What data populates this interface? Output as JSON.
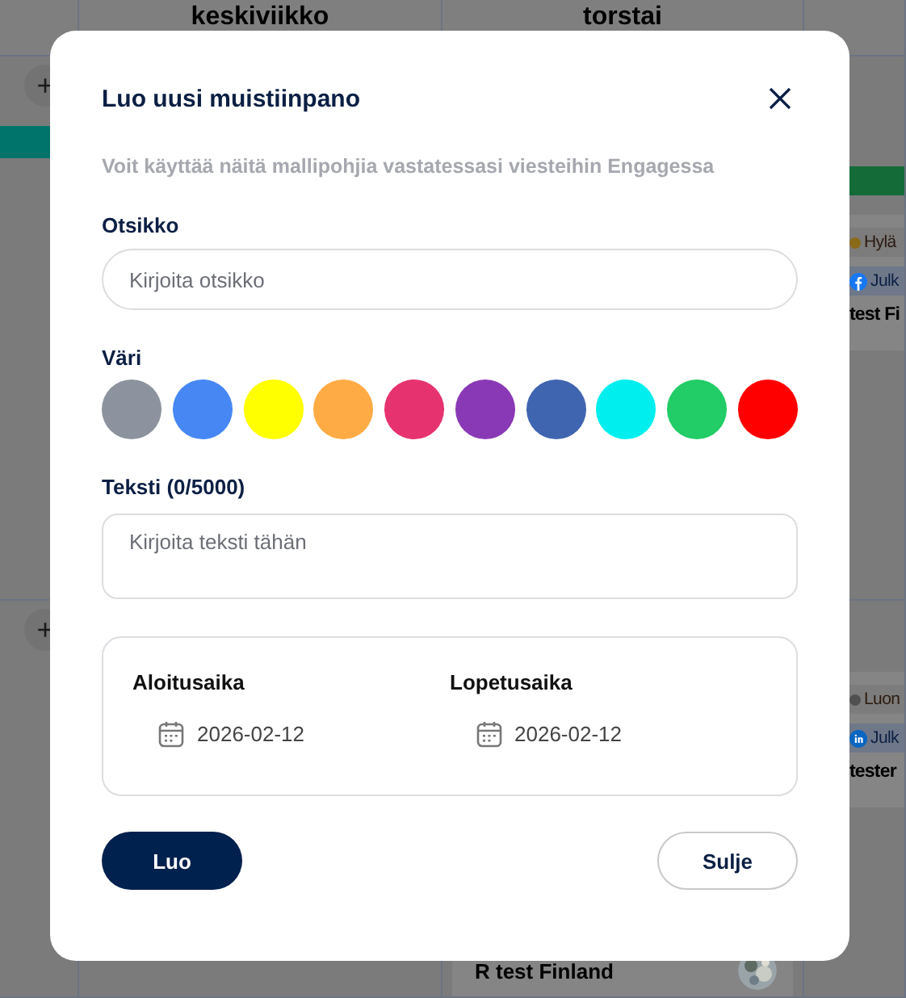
{
  "calendar": {
    "day_headers": [
      "keskiviikko",
      "torstai"
    ],
    "add_buttons": [
      "+",
      "+"
    ],
    "posts": [
      {
        "status": "Hylä",
        "color": "#8a6a18",
        "kind": "facebook",
        "channel": "Julk",
        "title": "test Fi"
      },
      {
        "status": "Luon",
        "color": "#505050",
        "kind": "linkedin",
        "channel": "Julk",
        "title": "tester"
      }
    ],
    "bottom_card": {
      "title": "R test Finland"
    }
  },
  "dialog": {
    "title": "Luo uusi muistiinpano",
    "subtitle": "Voit käyttää näitä mallipohjia vastatessasi viesteihin Engagessa",
    "title_field": {
      "label": "Otsikko",
      "placeholder": "Kirjoita otsikko"
    },
    "color_label": "Väri",
    "colors": [
      {
        "color": "#8c939e",
        "selected": false
      },
      {
        "color": "#4687f4",
        "selected": false
      },
      {
        "color": "#ffff00",
        "selected": false
      },
      {
        "color": "#ffab45",
        "selected": false
      },
      {
        "color": "#e6336f",
        "selected": false
      },
      {
        "color": "#8a39b6",
        "selected": false
      },
      {
        "color": "#4065b0",
        "selected": false
      },
      {
        "color": "#00eeee",
        "selected": false
      },
      {
        "color": "#22cc66",
        "selected": false
      },
      {
        "color": "#ff0000",
        "selected": false
      }
    ],
    "text_field": {
      "label": "Teksti (0/5000)",
      "placeholder": "Kirjoita teksti tähän"
    },
    "dates": [
      {
        "label": "Aloitusaika",
        "value": "2026-02-12"
      },
      {
        "label": "Lopetusaika",
        "value": "2026-02-12"
      }
    ],
    "buttons": [
      {
        "label": "Luo",
        "kind": "primary"
      },
      {
        "label": "Sulje",
        "kind": "secondary"
      }
    ]
  }
}
